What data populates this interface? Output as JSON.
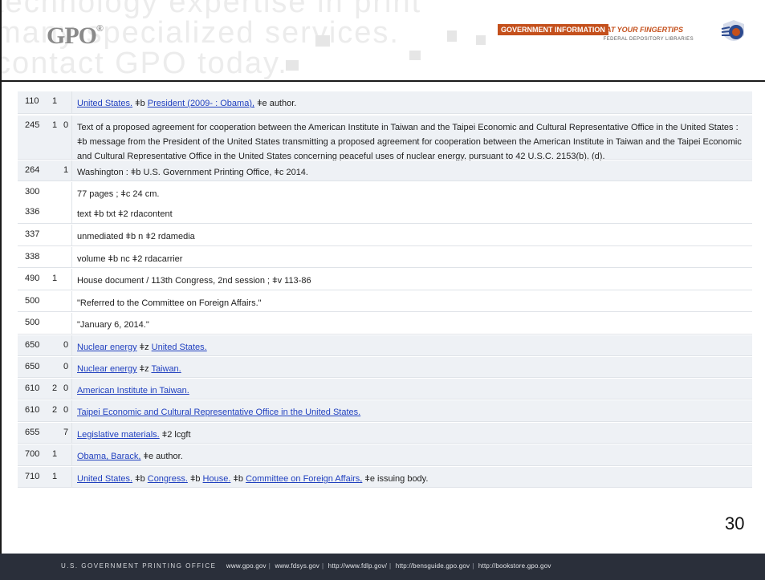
{
  "header": {
    "ghost_text": "technology expertise in print\nmany specialized services.\ncontact GPO today.",
    "logo_text": "G",
    "logo_text2": "PO",
    "logo_sup": "®",
    "fdlp_tag": "GOVERNMENT INFORMATION",
    "fdlp_tag2": "AT YOUR FINGERTIPS",
    "fdlp_sub": "FEDERAL DEPOSITORY LIBRARIES"
  },
  "record": {
    "rows": [
      {
        "tag": "110",
        "ind1": "1",
        "ind2": "",
        "parts": [
          {
            "t": "link",
            "v": "United States."
          },
          {
            "t": "text",
            "v": " ǂb "
          },
          {
            "t": "link",
            "v": "President (2009- : Obama),"
          },
          {
            "t": "text",
            "v": " ǂe author."
          }
        ]
      },
      {
        "tag": "245",
        "ind1": "1",
        "ind2": "0",
        "parts": [
          {
            "t": "text",
            "v": "Text of a proposed agreement for cooperation between the American Institute in Taiwan and the Taipei Economic and Cultural Representative Office in the United States : ǂb message from the President of the United States transmitting a proposed agreement for cooperation between the American Institute in Taiwan and the Taipei Economic and Cultural Representative Office in the United States concerning peaceful uses of nuclear energy, pursuant to 42 U.S.C. 2153(b), (d)."
          }
        ]
      },
      {
        "tag": "264",
        "ind1": "",
        "ind2": "1",
        "parts": [
          {
            "t": "text",
            "v": "Washington : ǂb U.S. Government Printing Office, ǂc 2014."
          }
        ]
      },
      {
        "tag": "300",
        "ind1": "",
        "ind2": "",
        "parts": [
          {
            "t": "text",
            "v": "77 pages ; ǂc 24 cm."
          }
        ]
      },
      {
        "tag": "336",
        "ind1": "",
        "ind2": "",
        "parts": [
          {
            "t": "text",
            "v": "text ǂb txt ǂ2 rdacontent"
          }
        ]
      },
      {
        "tag": "337",
        "ind1": "",
        "ind2": "",
        "parts": [
          {
            "t": "text",
            "v": "unmediated ǂb n ǂ2 rdamedia"
          }
        ]
      },
      {
        "tag": "338",
        "ind1": "",
        "ind2": "",
        "parts": [
          {
            "t": "text",
            "v": "volume ǂb nc ǂ2 rdacarrier"
          }
        ]
      },
      {
        "tag": "490",
        "ind1": "1",
        "ind2": "",
        "parts": [
          {
            "t": "text",
            "v": "House document / 113th Congress, 2nd session ; ǂv 113-86"
          }
        ]
      },
      {
        "tag": "500",
        "ind1": "",
        "ind2": "",
        "parts": [
          {
            "t": "text",
            "v": "\"Referred to the Committee on Foreign Affairs.\""
          }
        ]
      },
      {
        "tag": "500",
        "ind1": "",
        "ind2": "",
        "parts": [
          {
            "t": "text",
            "v": "\"January 6, 2014.\""
          }
        ]
      },
      {
        "tag": "650",
        "ind1": "",
        "ind2": "0",
        "parts": [
          {
            "t": "link",
            "v": "Nuclear energy"
          },
          {
            "t": "text",
            "v": " ǂz "
          },
          {
            "t": "link",
            "v": "United States."
          }
        ]
      },
      {
        "tag": "650",
        "ind1": "",
        "ind2": "0",
        "parts": [
          {
            "t": "link",
            "v": "Nuclear energy"
          },
          {
            "t": "text",
            "v": " ǂz "
          },
          {
            "t": "link",
            "v": "Taiwan."
          }
        ]
      },
      {
        "tag": "610",
        "ind1": "2",
        "ind2": "0",
        "parts": [
          {
            "t": "link",
            "v": "American Institute in Taiwan."
          }
        ]
      },
      {
        "tag": "610",
        "ind1": "2",
        "ind2": "0",
        "parts": [
          {
            "t": "link",
            "v": "Taipei Economic and Cultural Representative Office in the United States."
          }
        ]
      },
      {
        "tag": "655",
        "ind1": "",
        "ind2": "7",
        "parts": [
          {
            "t": "link",
            "v": "Legislative materials."
          },
          {
            "t": "text",
            "v": " ǂ2 lcgft"
          }
        ]
      },
      {
        "tag": "700",
        "ind1": "1",
        "ind2": "",
        "parts": [
          {
            "t": "link",
            "v": "Obama, Barack,"
          },
          {
            "t": "text",
            "v": " ǂe author."
          }
        ]
      },
      {
        "tag": "710",
        "ind1": "1",
        "ind2": "",
        "parts": [
          {
            "t": "link",
            "v": "United States."
          },
          {
            "t": "text",
            "v": " ǂb "
          },
          {
            "t": "link",
            "v": "Congress."
          },
          {
            "t": "text",
            "v": " ǂb "
          },
          {
            "t": "link",
            "v": "House."
          },
          {
            "t": "text",
            "v": " ǂb "
          },
          {
            "t": "link",
            "v": "Committee on Foreign Affairs,"
          },
          {
            "t": "text",
            "v": " ǂe issuing body."
          }
        ]
      }
    ]
  },
  "slide_number": "30",
  "footer": {
    "org": "U.S. GOVERNMENT PRINTING OFFICE",
    "links": [
      "www.gpo.gov",
      "www.fdsys.gov",
      "http://www.fdlp.gov/",
      "http://bensguide.gpo.gov",
      "http://bookstore.gpo.gov"
    ]
  },
  "colors": {
    "link": "#1f3fbf",
    "footer_bg": "#2a2f3a",
    "accent": "#c4501c"
  }
}
